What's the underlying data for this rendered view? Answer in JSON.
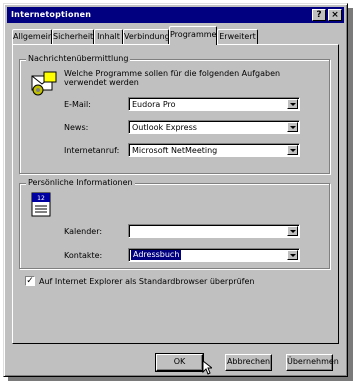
{
  "window": {
    "title": "Internetoptionen",
    "help_glyph": "?",
    "close_glyph": "×"
  },
  "tabs": [
    {
      "label": "Allgemein"
    },
    {
      "label": "Sicherheit"
    },
    {
      "label": "Inhalt"
    },
    {
      "label": "Verbindung"
    },
    {
      "label": "Programme"
    },
    {
      "label": "Erweitert"
    }
  ],
  "messaging": {
    "group_label": "Nachrichtenübermittlung",
    "description": "Welche Programme sollen für die folgenden Aufgaben verwendet werden",
    "email_label": "E-Mail:",
    "email_value": "Eudora Pro",
    "news_label": "News:",
    "news_value": "Outlook Express",
    "internetcall_label": "Internetanruf:",
    "internetcall_value": "Microsoft NetMeeting"
  },
  "personal": {
    "group_label": "Persönliche Informationen",
    "calendar_label": "Kalender:",
    "calendar_value": "",
    "contacts_label": "Kontakte:",
    "contacts_value": "Adressbuch"
  },
  "check": {
    "label": "Auf Internet Explorer als Standardbrowser überprüfen",
    "checked_glyph": "✓"
  },
  "buttons": {
    "ok": "OK",
    "cancel": "Abbrechen",
    "apply": "Übernehmen"
  }
}
